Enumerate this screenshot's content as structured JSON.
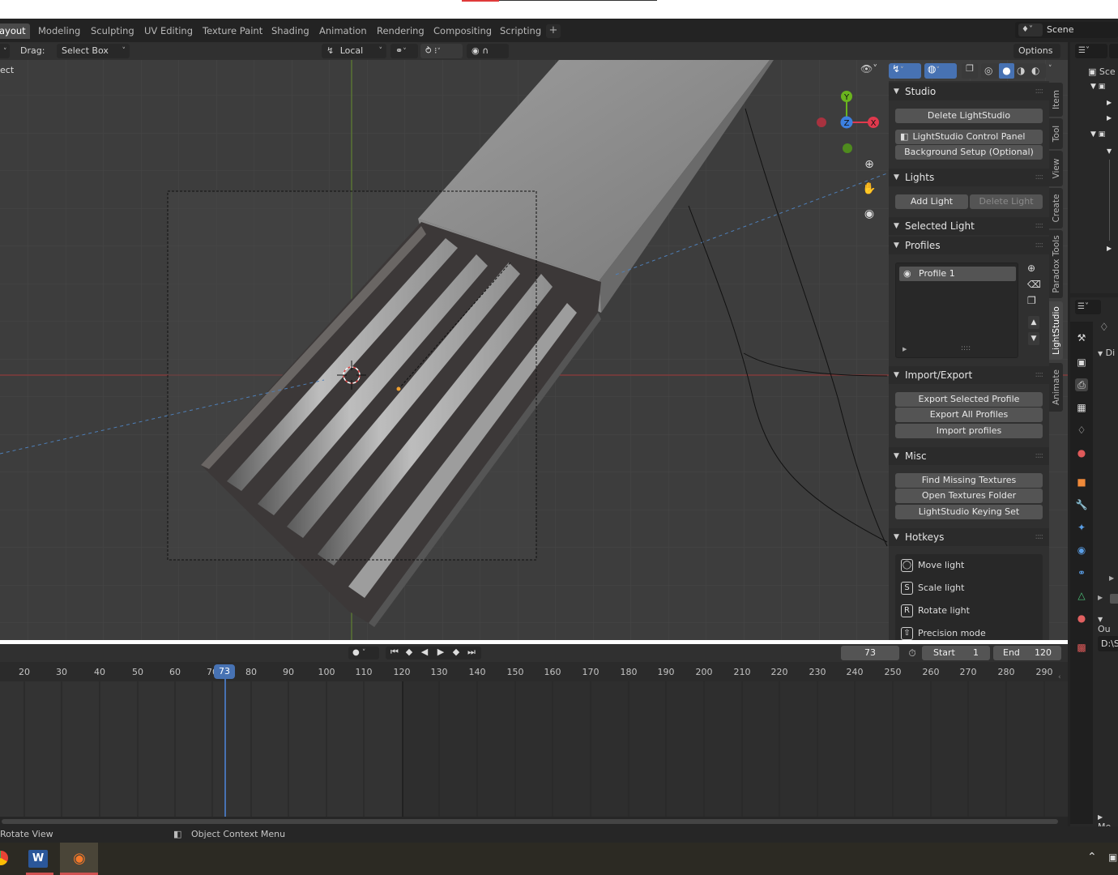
{
  "workspace_tabs": [
    "ayout",
    "Modeling",
    "Sculpting",
    "UV Editing",
    "Texture Paint",
    "Shading",
    "Animation",
    "Rendering",
    "Compositing",
    "Scripting"
  ],
  "scene_name": "Scene",
  "header": {
    "drag_label": "Drag:",
    "drag_value": "Select Box",
    "orientation": "Local",
    "options_label": "Options",
    "select_partial": "ect"
  },
  "npanel": {
    "studio": {
      "title": "Studio",
      "delete_btn": "Delete LightStudio",
      "control_panel_btn": "LightStudio Control Panel",
      "background_btn": "Background Setup (Optional)"
    },
    "lights": {
      "title": "Lights",
      "add_btn": "Add Light",
      "delete_btn": "Delete Light"
    },
    "selected_light": {
      "title": "Selected Light"
    },
    "profiles": {
      "title": "Profiles",
      "items": [
        "Profile 1"
      ]
    },
    "import_export": {
      "title": "Import/Export",
      "export_selected": "Export Selected Profile",
      "export_all": "Export All Profiles",
      "import": "Import profiles"
    },
    "misc": {
      "title": "Misc",
      "find_missing": "Find Missing Textures",
      "open_folder": "Open Textures Folder",
      "keying_set": "LightStudio Keying Set"
    },
    "hotkeys": {
      "title": "Hotkeys",
      "items": [
        {
          "key": "",
          "label": "Move light"
        },
        {
          "key": "S",
          "label": "Scale light"
        },
        {
          "key": "R",
          "label": "Rotate light"
        },
        {
          "key": "⇧",
          "label": "Precision mode"
        }
      ]
    }
  },
  "vertical_tabs": [
    "Item",
    "Tool",
    "View",
    "Create",
    "Paradox Tools",
    "LightStudio",
    "Animate"
  ],
  "gizmo": {
    "y": "Y",
    "z": "Z",
    "x": "X"
  },
  "timeline": {
    "current_frame": "73",
    "start_label": "Start",
    "start_value": "1",
    "end_label": "End",
    "end_value": "120",
    "ticks": [
      "20",
      "30",
      "40",
      "50",
      "60",
      "70",
      "80",
      "90",
      "100",
      "110",
      "120",
      "130",
      "140",
      "150",
      "160",
      "170",
      "180",
      "190",
      "200",
      "210",
      "220",
      "230",
      "240",
      "250",
      "260",
      "270",
      "280",
      "290"
    ]
  },
  "status": {
    "left": "Rotate View",
    "middle": "Object Context Menu"
  },
  "props_partial": {
    "di": "Di",
    "ou": "Ou",
    "path": "D:\\S",
    "me": "Me",
    "sce": "Sce"
  },
  "colors": {
    "accent_blue": "#4772b3",
    "x_axis": "#e0394d",
    "y_axis": "#6ab41e",
    "z_axis": "#3c80e0"
  }
}
